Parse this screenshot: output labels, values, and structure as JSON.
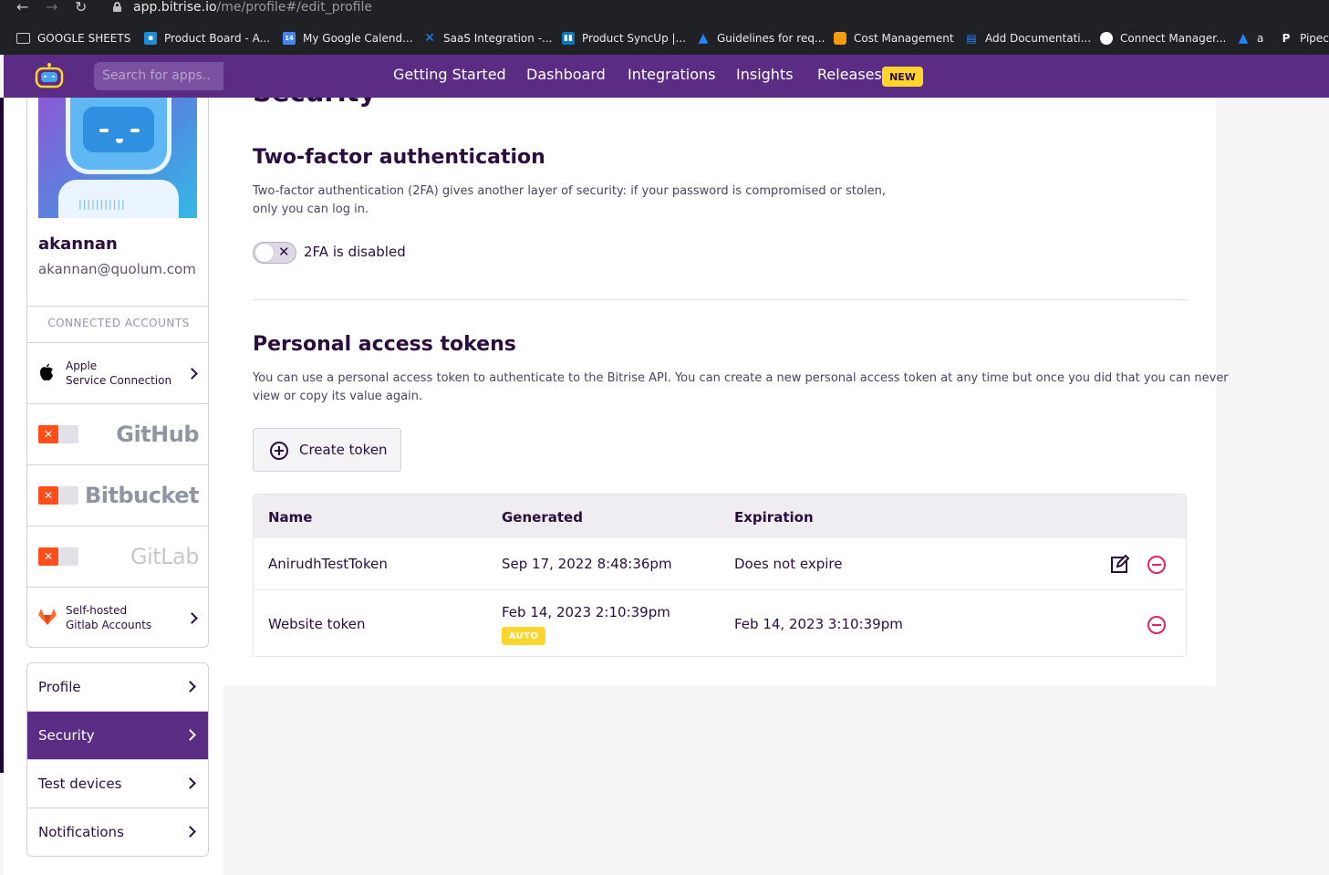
{
  "browser": {
    "url_host": "app.bitrise.io",
    "url_path": "/me/profile#/edit_profile",
    "bookmarks": [
      {
        "label": "GOOGLE SHEETS",
        "icon": "folder-icon"
      },
      {
        "label": "Product Board - A...",
        "icon": "productboard-icon"
      },
      {
        "label": "My Google Calend...",
        "icon": "calendar-icon"
      },
      {
        "label": "SaaS Integration -...",
        "icon": "confluence-icon"
      },
      {
        "label": "Product SyncUp |...",
        "icon": "trello-icon"
      },
      {
        "label": "Guidelines for req...",
        "icon": "atlassian-icon"
      },
      {
        "label": "Cost Management",
        "icon": "aws-icon"
      },
      {
        "label": "Add Documentati...",
        "icon": "book-icon"
      },
      {
        "label": "Connect Manager...",
        "icon": "github-icon"
      },
      {
        "label": "a",
        "icon": "atlassian-icon"
      },
      {
        "label": "Pipec",
        "icon": "pipedrive-icon"
      }
    ]
  },
  "header": {
    "search_placeholder": "Search for apps..",
    "nav": [
      "Getting Started",
      "Dashboard",
      "Integrations",
      "Insights",
      "Releases"
    ],
    "new_badge": "NEW",
    "colors": {
      "bar": "#5b2c83",
      "badge": "#ffd52c"
    }
  },
  "profile": {
    "username": "akannan",
    "email": "akannan@quolum.com",
    "connected_accounts_title": "CONNECTED ACCOUNTS",
    "apple": {
      "line1": "Apple",
      "line2": "Service Connection"
    },
    "services": [
      {
        "name": "GitHub",
        "connected": false
      },
      {
        "name": "Bitbucket",
        "connected": false
      },
      {
        "name": "GitLab",
        "connected": false
      }
    ],
    "self_hosted": {
      "line1": "Self-hosted",
      "line2": "Gitlab Accounts"
    },
    "disconnect_mark": "✕"
  },
  "menu": {
    "items": [
      "Profile",
      "Security",
      "Test devices",
      "Notifications"
    ],
    "active": "Security"
  },
  "security": {
    "title": "Security",
    "tfa": {
      "heading": "Two-factor authentication",
      "desc_line1": "Two-factor authentication (2FA) gives another layer of security: if your password is compromised or stolen,",
      "desc_line2": "only you can log in.",
      "status": "2FA is disabled",
      "enabled": false,
      "toggle_mark": "✕"
    },
    "tokens": {
      "heading": "Personal access tokens",
      "desc_line1": "You can use a personal access token to authenticate to the Bitrise API. You can create a new personal access token at any time but once you did that you can never",
      "desc_line2": "view or copy its value again.",
      "create_label": "Create token",
      "columns": [
        "Name",
        "Generated",
        "Expiration"
      ],
      "rows": [
        {
          "name": "AnirudhTestToken",
          "generated": "Sep 17, 2022 8:48:36pm",
          "expiration": "Does not expire",
          "badge": "",
          "editable": true
        },
        {
          "name": "Website token",
          "generated": "Feb 14, 2023 2:10:39pm",
          "expiration": "Feb 14, 2023 3:10:39pm",
          "badge": "AUTO",
          "editable": false
        }
      ]
    }
  }
}
